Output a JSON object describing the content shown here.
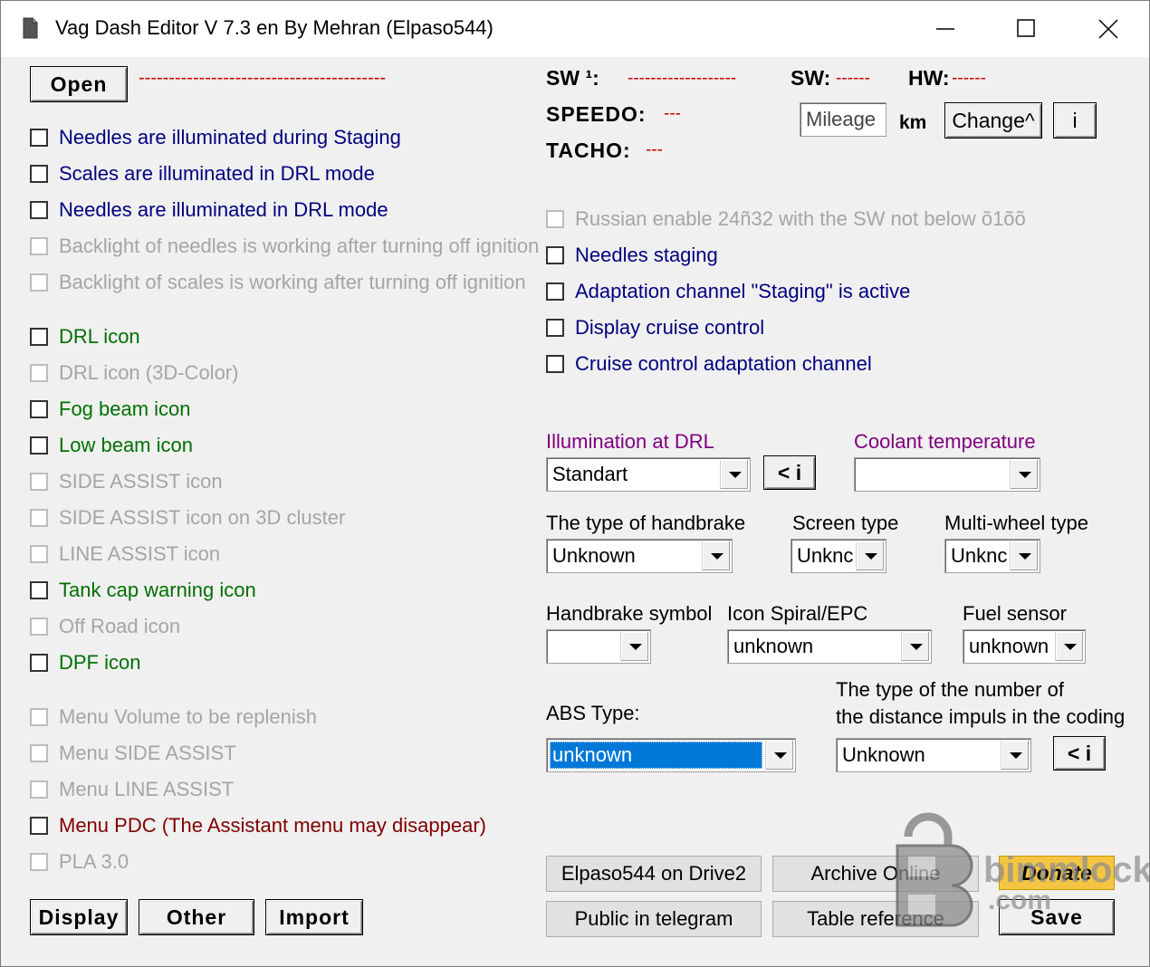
{
  "window": {
    "title": "Vag Dash Editor V 7.3 en By Mehran (Elpaso544)",
    "minimize_icon": "minimize-icon",
    "maximize_icon": "maximize-icon",
    "close_icon": "close-icon"
  },
  "top": {
    "open_label": "Open",
    "sw1_label": "SW ¹:",
    "sw1_value": "-------------------",
    "sw_label": "SW:",
    "sw_value": "------",
    "hw_label": "HW:",
    "hw_value": "------",
    "speedo_label": "SPEEDO:",
    "speedo_value": "---",
    "tacho_label": "TACHO:",
    "tacho_value": "---",
    "mileage_placeholder": "Mileage",
    "km_label": "km",
    "change_label": "Change^",
    "info_label": "i"
  },
  "left_checkboxes": [
    {
      "label": "Needles are illuminated during Staging",
      "style": "blue"
    },
    {
      "label": "Scales are illuminated in DRL mode",
      "style": "blue"
    },
    {
      "label": "Needles are illuminated in DRL mode",
      "style": "blue"
    },
    {
      "label": "Backlight of needles is working after turning off ignition",
      "style": "gray"
    },
    {
      "label": "Backlight of scales is working after turning off ignition",
      "style": "gray"
    },
    {
      "label": "DRL icon",
      "style": "green"
    },
    {
      "label": "DRL icon (3D-Color)",
      "style": "gray"
    },
    {
      "label": "Fog beam icon",
      "style": "green"
    },
    {
      "label": "Low beam icon",
      "style": "green"
    },
    {
      "label": "SIDE ASSIST icon",
      "style": "gray"
    },
    {
      "label": "SIDE ASSIST icon on 3D cluster",
      "style": "gray"
    },
    {
      "label": "LINE ASSIST icon",
      "style": "gray"
    },
    {
      "label": "Tank cap warning icon",
      "style": "green"
    },
    {
      "label": "Off Road icon",
      "style": "gray"
    },
    {
      "label": "DPF icon",
      "style": "green"
    },
    {
      "label": "Menu Volume to be replenish",
      "style": "gray"
    },
    {
      "label": "Menu SIDE ASSIST",
      "style": "gray"
    },
    {
      "label": "Menu LINE ASSIST",
      "style": "gray"
    },
    {
      "label": "Menu PDC (The Assistant menu may disappear)",
      "style": "maroon"
    },
    {
      "label": "PLA 3.0",
      "style": "gray"
    }
  ],
  "right_checkboxes": [
    {
      "label": "Russian enable  24ñ32 with the SW not below õ1õõ",
      "style": "gray"
    },
    {
      "label": "Needles staging",
      "style": "blue"
    },
    {
      "label": "Adaptation channel \"Staging\" is active",
      "style": "blue"
    },
    {
      "label": "Display cruise control",
      "style": "blue"
    },
    {
      "label": "Cruise control adaptation channel",
      "style": "blue"
    }
  ],
  "fields": {
    "illumination_label": "Illumination at DRL",
    "illumination_value": "Standart",
    "illumination_info": "< i",
    "coolant_label": "Coolant temperature",
    "coolant_value": "",
    "handbrake_type_label": "The type of handbrake",
    "handbrake_type_value": "Unknown",
    "screen_type_label": "Screen type",
    "screen_type_value": "Unknc",
    "multiwheel_label": "Multi-wheel type",
    "multiwheel_value": "Unknc",
    "handbrake_symbol_label": "Handbrake symbol",
    "handbrake_symbol_value": "",
    "icon_spiral_label": "Icon Spiral/EPC",
    "icon_spiral_value": "unknown",
    "fuel_sensor_label": "Fuel sensor",
    "fuel_sensor_value": "unknown",
    "abs_label": "ABS Type:",
    "abs_value": "unknown",
    "distance_label_1": "The type of the number of",
    "distance_label_2": "the distance impuls in the coding",
    "distance_value": "Unknown",
    "distance_info": "< i"
  },
  "bottom": {
    "display_label": "Display",
    "other_label": "Other",
    "import_label": "Import",
    "drive2_label": "Elpaso544 on Drive2",
    "archive_label": "Archive Online",
    "donate_label": "Donate",
    "telegram_label": "Public in telegram",
    "table_label": "Table reference",
    "save_label": "Save"
  },
  "watermark": {
    "text_1": "bimmlock",
    "text_2": ".com"
  },
  "colors": {
    "blue_text": "#000080",
    "green_text": "#007000",
    "disabled_text": "#a5a5a5",
    "maroon_text": "#800000",
    "purple_text": "#800080",
    "dash_red": "#d21f1f",
    "selection": "#0078d7"
  }
}
